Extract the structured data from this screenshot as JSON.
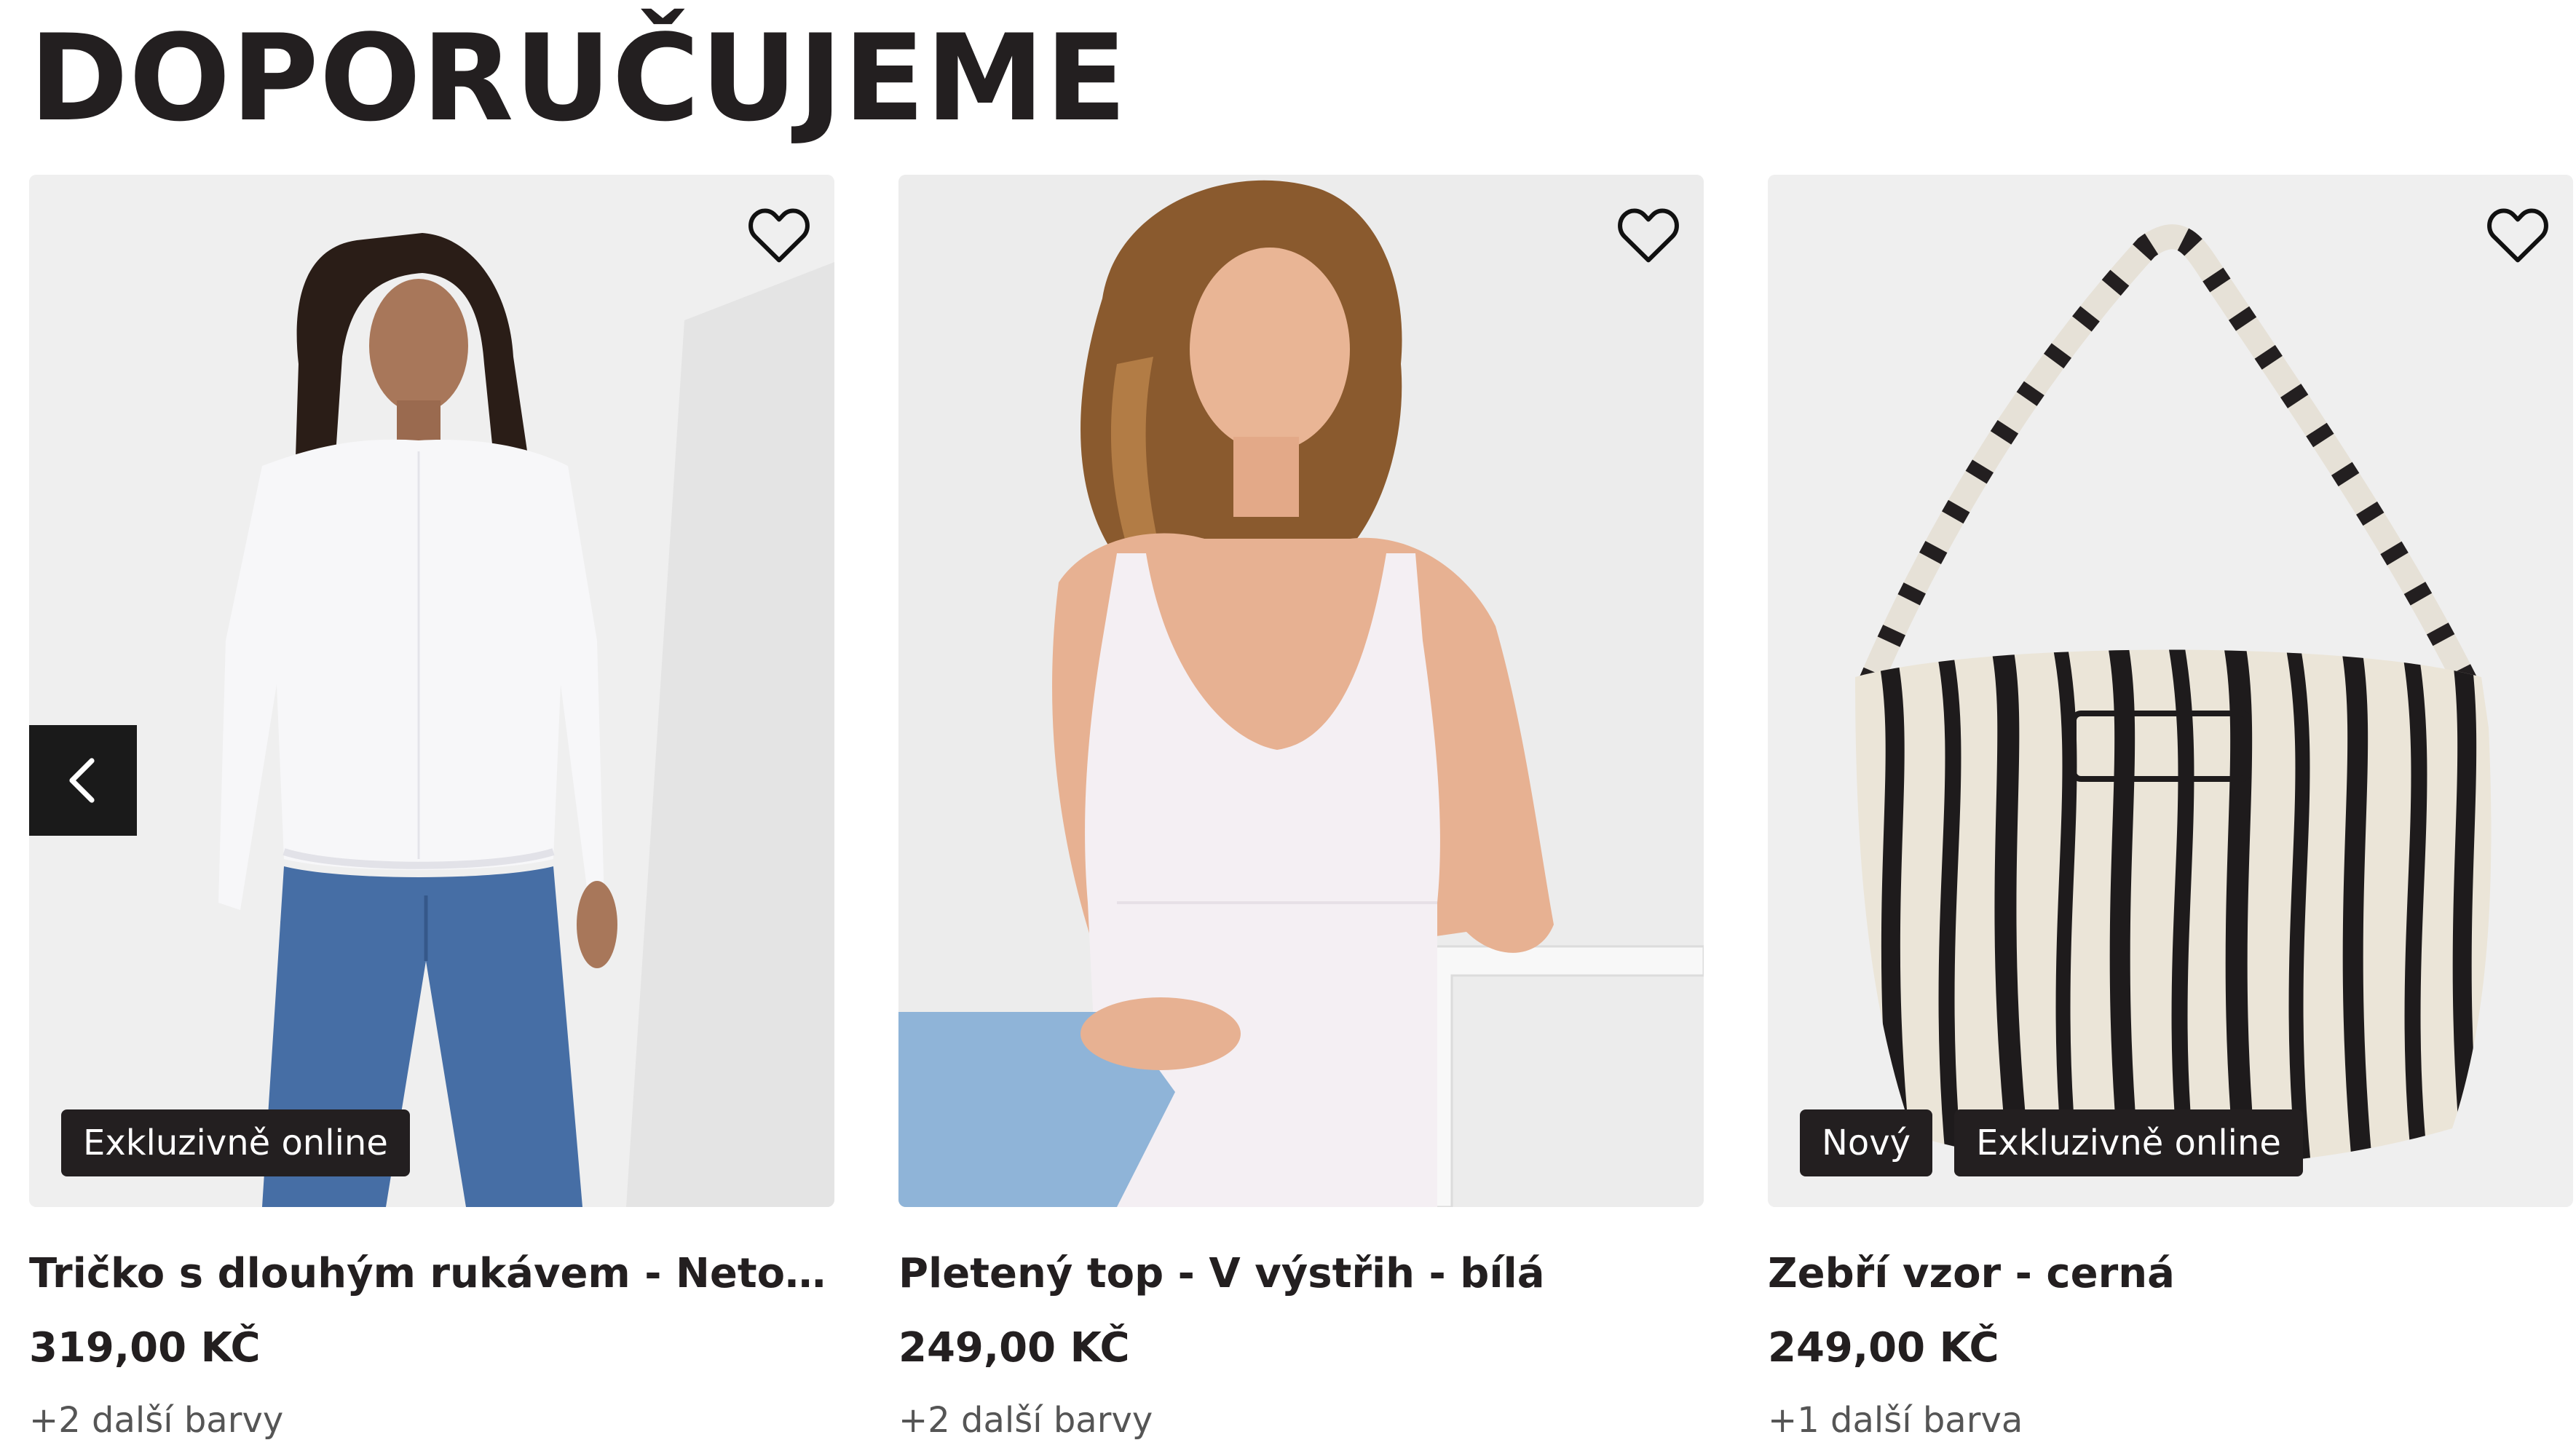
{
  "section": {
    "title": "DOPORUČUJEME"
  },
  "carousel": {
    "prev_icon": "chevron-left-icon",
    "products": [
      {
        "name": "Tričko s dlouhým rukávem - Netopýří r...",
        "price": "319,00 KČ",
        "colors": "+2 další barvy",
        "badges": [
          "Exkluzivně online"
        ],
        "favorite_icon": "heart-outline-icon"
      },
      {
        "name": "Pletený top - V výstřih - bílá",
        "price": "249,00 KČ",
        "colors": "+2 další barvy",
        "badges": [],
        "favorite_icon": "heart-outline-icon"
      },
      {
        "name": "Zebří vzor - cerná",
        "price": "249,00 KČ",
        "colors": "+1 další barva",
        "badges": [
          "Nový",
          "Exkluzivně online"
        ],
        "favorite_icon": "heart-outline-icon"
      }
    ]
  },
  "colors": {
    "text": "#231f20",
    "badge_bg": "#231f20",
    "image_bg": "#ededed",
    "arrow_bg": "#1a1a1a"
  }
}
